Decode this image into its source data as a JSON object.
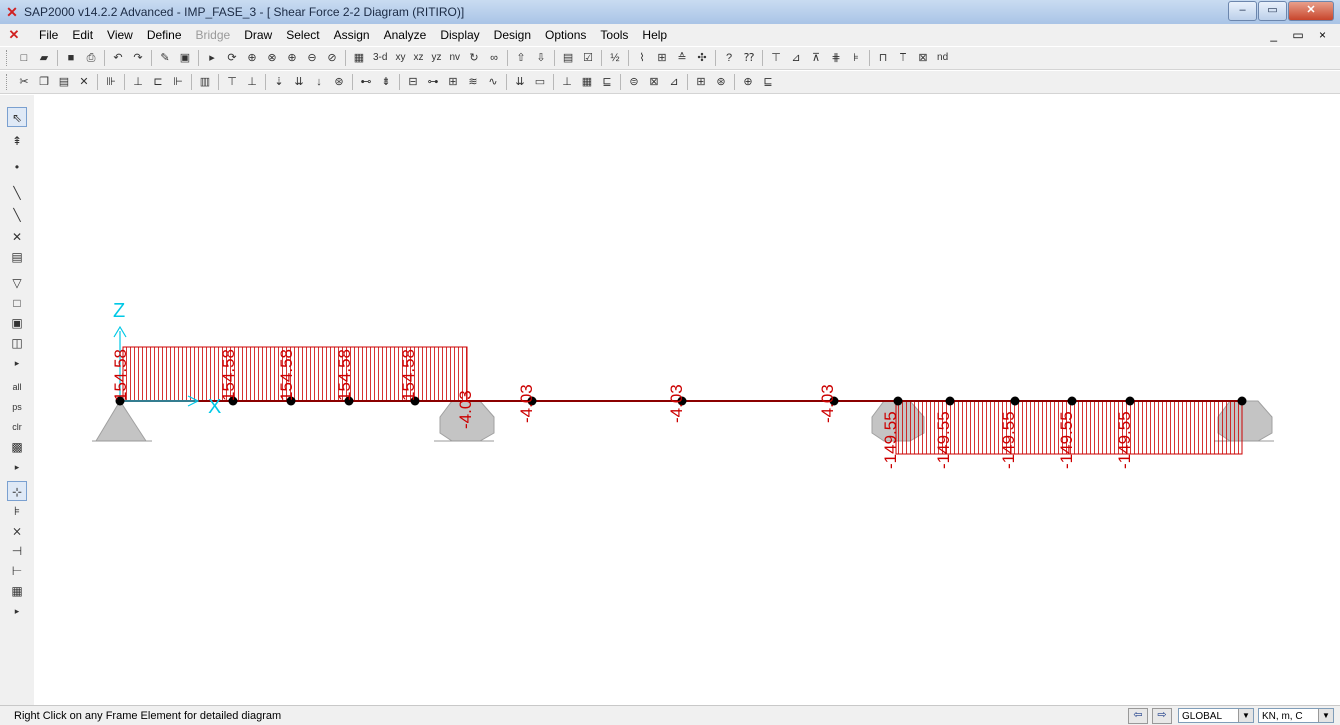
{
  "window": {
    "title": "SAP2000 v14.2.2 Advanced  - IMP_FASE_3 - [  Shear Force 2-2 Diagram   (RITIRO)]",
    "app_icon": "sap2000-logo-icon",
    "controls": {
      "minimize": "–",
      "restore": "▭",
      "close": "✕"
    }
  },
  "menu": {
    "items": [
      {
        "label": "File",
        "enabled": true
      },
      {
        "label": "Edit",
        "enabled": true
      },
      {
        "label": "View",
        "enabled": true
      },
      {
        "label": "Define",
        "enabled": true
      },
      {
        "label": "Bridge",
        "enabled": false
      },
      {
        "label": "Draw",
        "enabled": true
      },
      {
        "label": "Select",
        "enabled": true
      },
      {
        "label": "Assign",
        "enabled": true
      },
      {
        "label": "Analyze",
        "enabled": true
      },
      {
        "label": "Display",
        "enabled": true
      },
      {
        "label": "Design",
        "enabled": true
      },
      {
        "label": "Options",
        "enabled": true
      },
      {
        "label": "Tools",
        "enabled": true
      },
      {
        "label": "Help",
        "enabled": true
      }
    ],
    "mdi_controls": "_ ▭ ×"
  },
  "toolbar1": {
    "view_labels": {
      "3d": "3-d",
      "xy": "xy",
      "xz": "xz",
      "yz": "yz",
      "nv": "nv"
    },
    "nd_label": "nd"
  },
  "diagram": {
    "axis_z": "Z",
    "axis_x": "X",
    "labels": [
      "154.58",
      "154.58",
      "154.58",
      "154.58",
      "154.58",
      "-4.03",
      "-4.03",
      "-4.03",
      "-4.03",
      "-149.55",
      "-149.55",
      "-149.55",
      "-149.55",
      "-149.55"
    ],
    "colors": {
      "diagram": "#cc0000",
      "axes": "#00c8e6",
      "support": "#c0c0c0",
      "node": "#000000"
    }
  },
  "status": {
    "message": "Right Click on any Frame Element for detailed diagram",
    "coord_system": "GLOBAL",
    "units": "KN, m, C"
  }
}
